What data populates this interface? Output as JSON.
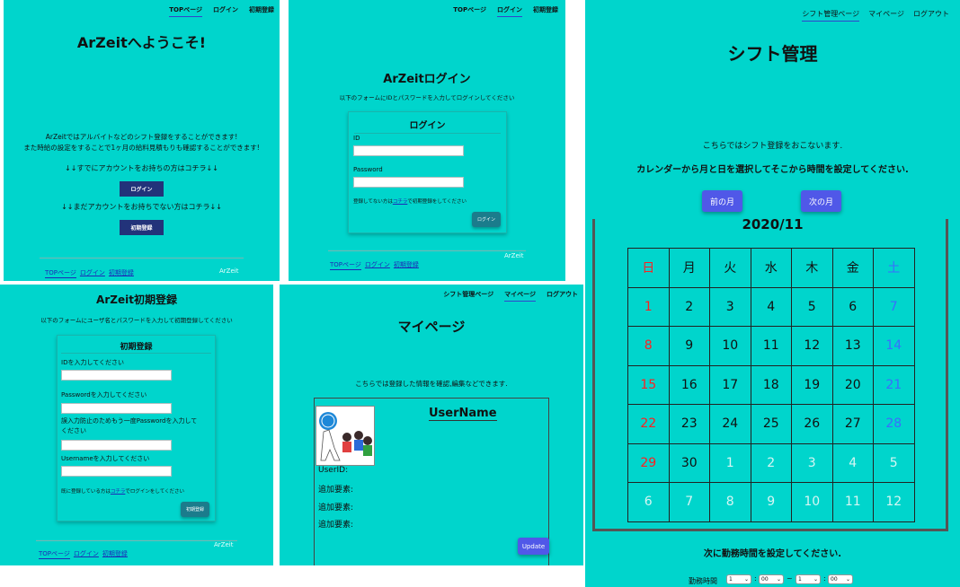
{
  "colors": {
    "panel_bg": "#00d5cc",
    "navy": "#22337a",
    "purple": "#5058e8",
    "red": "#ff2020",
    "blue": "#3a6cff",
    "faded": "#d6f6f4"
  },
  "top_page": {
    "nav": [
      "TOPページ",
      "ログイン",
      "初期登録"
    ],
    "title": "ArZeitへようこそ!",
    "desc1": "ArZeitではアルバイトなどのシフト登録をすることができます!",
    "desc2": "また時給の設定をすることで1ヶ月の給料見積もりも確認することができます!",
    "have_account": "↓↓すでにアカウントをお持ちの方はコチラ↓↓",
    "login_button": "ログイン",
    "no_account": "↓↓まだアカウントをお持ちでない方はコチラ↓↓",
    "register_button": "初期登録",
    "footer": [
      "TOPページ",
      "ログイン",
      "初期登録"
    ],
    "brand": "ArZeit"
  },
  "login_page": {
    "nav": [
      "TOPページ",
      "ログイン",
      "初期登録"
    ],
    "title": "ArZeitログイン",
    "desc": "以下のフォームにIDとパスワードを入力してログインしてください",
    "card_title": "ログイン",
    "id_label": "ID",
    "password_label": "Password",
    "note_pre": "登録してない方は",
    "note_link": "コチラ",
    "note_post": "で初期登録をしてください",
    "submit": "ログイン",
    "footer": [
      "TOPページ",
      "ログイン",
      "初期登録"
    ],
    "brand": "ArZeit"
  },
  "register_page": {
    "title": "ArZeit初期登録",
    "desc": "以下のフォームにユーザ名とパスワードを入力して初期登録してください",
    "card_title": "初期登録",
    "id_label": "IDを入力してください",
    "password_label": "Passwordを入力してください",
    "confirm_label1": "誤入力防止のためもう一度Passwordを入力して",
    "confirm_label2": "ください",
    "username_label": "Usernameを入力してください",
    "note_pre": "既に登録している方は",
    "note_link": "コチラ",
    "note_post": "でログインをしてください",
    "submit": "初期登録",
    "footer": [
      "TOPページ",
      "ログイン",
      "初期登録"
    ],
    "brand": "ArZeit"
  },
  "mypage": {
    "nav": [
      "シフト管理ページ",
      "マイページ",
      "ログアウト"
    ],
    "title": "マイページ",
    "desc": "こちらでは登録した情報を確認,編集などできます.",
    "username": "UserName",
    "userid_label": "UserID:",
    "extra": [
      "追加要素:",
      "追加要素:",
      "追加要素:"
    ],
    "update_button": "Update"
  },
  "shift_page": {
    "nav": [
      "シフト管理ページ",
      "マイページ",
      "ログアウト"
    ],
    "title": "シフト管理",
    "desc1": "こちらではシフト登録をおこないます.",
    "desc2": "カレンダーから月と日を選択してそこから時間を設定してください.",
    "prev_button": "前の月",
    "next_button": "次の月",
    "month": "2020/11",
    "weekdays": [
      "日",
      "月",
      "火",
      "水",
      "木",
      "金",
      "土"
    ],
    "weeks": [
      [
        "1",
        "2",
        "3",
        "4",
        "5",
        "6",
        "7"
      ],
      [
        "8",
        "9",
        "10",
        "11",
        "12",
        "13",
        "14"
      ],
      [
        "15",
        "16",
        "17",
        "18",
        "19",
        "20",
        "21"
      ],
      [
        "22",
        "23",
        "24",
        "25",
        "26",
        "27",
        "28"
      ],
      [
        "29",
        "30",
        "1",
        "2",
        "3",
        "4",
        "5"
      ],
      [
        "6",
        "7",
        "8",
        "9",
        "10",
        "11",
        "12"
      ]
    ],
    "next_step": "次に勤務時間を設定してください.",
    "time_label": "勤務時間",
    "time_selects": [
      "1",
      "00",
      "1",
      "00"
    ],
    "colon": ":",
    "tilde": "~"
  }
}
